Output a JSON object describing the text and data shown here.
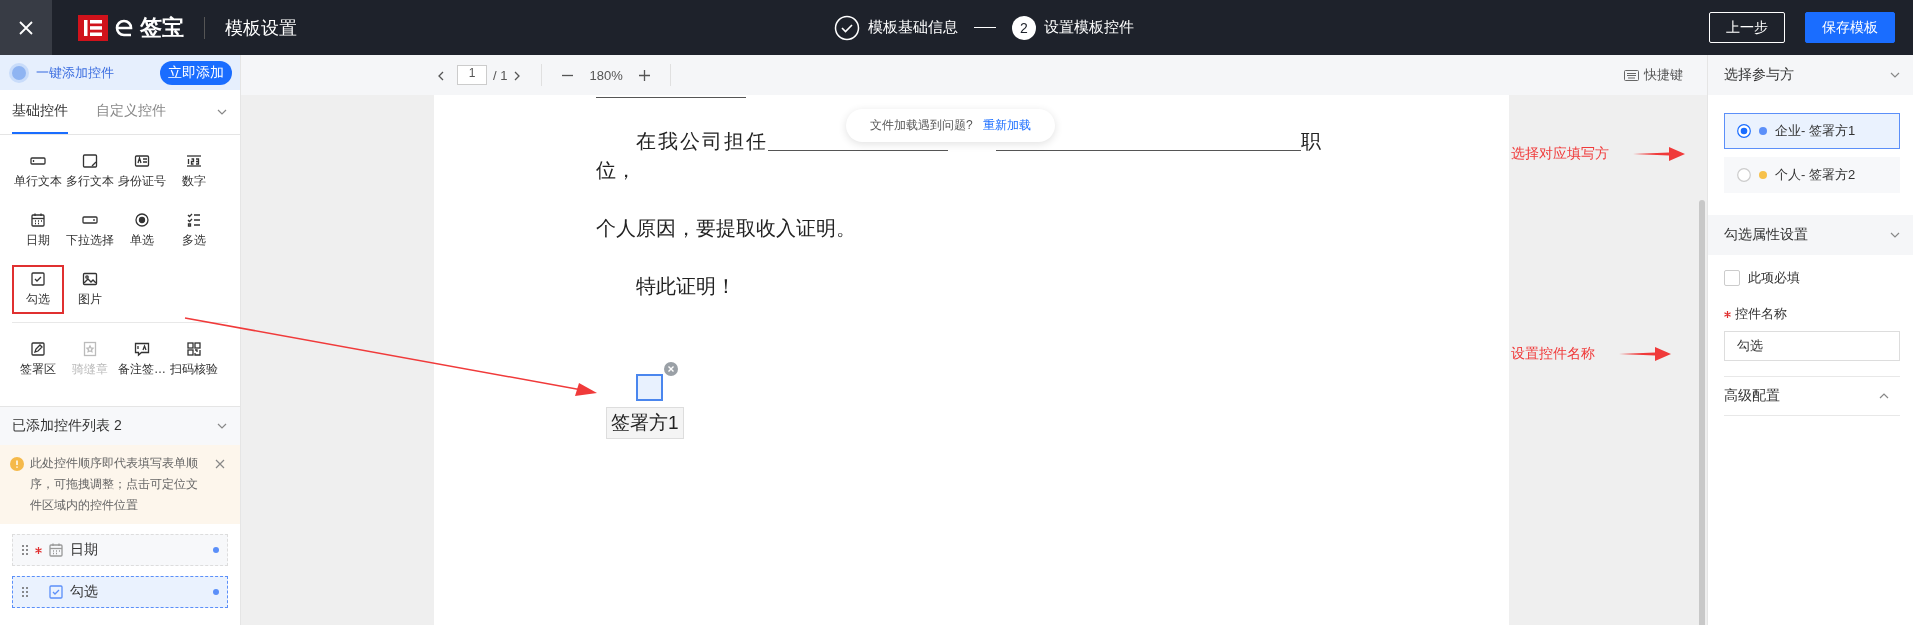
{
  "topbar": {
    "logo": "签宝",
    "title": "模板设置",
    "steps": [
      {
        "label": "模板基础信息",
        "done": true
      },
      {
        "label": "设置模板控件",
        "number": "2",
        "done": false
      }
    ],
    "buttons": [
      {
        "label": "上一步",
        "kind": "secondary"
      },
      {
        "label": "保存模板",
        "kind": "primary"
      }
    ]
  },
  "left_panel": {
    "ai_bar": {
      "text": "一键添加控件",
      "button": "立即添加"
    },
    "tabs": [
      {
        "label": "基础控件",
        "selected": true
      },
      {
        "label": "自定义控件",
        "selected": false
      }
    ],
    "control_groups": [
      [
        {
          "label": "单行文本",
          "kind": "single-line",
          "disabled": false,
          "highlighted": false
        },
        {
          "label": "多行文本",
          "kind": "multi-line",
          "disabled": false,
          "highlighted": false
        },
        {
          "label": "身份证号",
          "kind": "id-card",
          "disabled": false,
          "highlighted": false
        },
        {
          "label": "数字",
          "kind": "number",
          "disabled": false,
          "highlighted": false
        },
        {
          "label": "日期",
          "kind": "date",
          "disabled": false,
          "highlighted": false
        },
        {
          "label": "下拉选择",
          "kind": "dropdown",
          "disabled": false,
          "highlighted": false
        },
        {
          "label": "单选",
          "kind": "radio",
          "disabled": false,
          "highlighted": false
        },
        {
          "label": "多选",
          "kind": "multi-select",
          "disabled": false,
          "highlighted": false
        },
        {
          "label": "勾选",
          "kind": "checkbox",
          "disabled": false,
          "highlighted": true
        },
        {
          "label": "图片",
          "kind": "image",
          "disabled": false,
          "highlighted": false
        }
      ],
      [
        {
          "label": "签署区",
          "kind": "signature",
          "disabled": false,
          "highlighted": false
        },
        {
          "label": "骑缝章",
          "kind": "seal",
          "disabled": true,
          "highlighted": false
        },
        {
          "label": "备注签…",
          "kind": "note",
          "disabled": false,
          "highlighted": false
        },
        {
          "label": "扫码核验",
          "kind": "scan",
          "disabled": false,
          "highlighted": false
        }
      ]
    ],
    "added_list": {
      "title": "已添加控件列表 2",
      "notice": "此处控件顺序即代表填写表单顺序，可拖拽调整；点击可定位文件区域内的控件位置",
      "items": [
        {
          "label": "日期",
          "kind": "date",
          "required": true,
          "selected": false
        },
        {
          "label": "勾选",
          "kind": "checkbox",
          "required": false,
          "selected": true
        }
      ]
    }
  },
  "toolbar": {
    "page": "1",
    "total": "/ 1",
    "zoom": "180%",
    "shortcut": "快捷键"
  },
  "toast": {
    "text": "文件加载遇到问题?",
    "link": "重新加载"
  },
  "document": {
    "line1_start": "在我公司担任",
    "line1_end": "职",
    "line1_wrap": "位，",
    "paragraphs": [
      "个人原因，要提取收入证明。",
      "特此证明！"
    ],
    "widget": {
      "label": "签署方1"
    }
  },
  "annotations": [
    {
      "text": "选择对应填写方"
    },
    {
      "text": "设置控件名称"
    }
  ],
  "right_panel": {
    "party_title": "选择参与方",
    "parties": [
      {
        "label": "企业- 签署方1",
        "color": "#5b8ff9",
        "selected": true
      },
      {
        "label": "个人- 签署方2",
        "color": "#f7c14b",
        "selected": false
      }
    ],
    "settings_title": "勾选属性设置",
    "required_checkbox": {
      "label": "此项必填",
      "checked": false
    },
    "name_field": {
      "label": "控件名称",
      "required": true,
      "value": "勾选"
    },
    "advanced": {
      "label": "高级配置",
      "expanded": true
    }
  }
}
